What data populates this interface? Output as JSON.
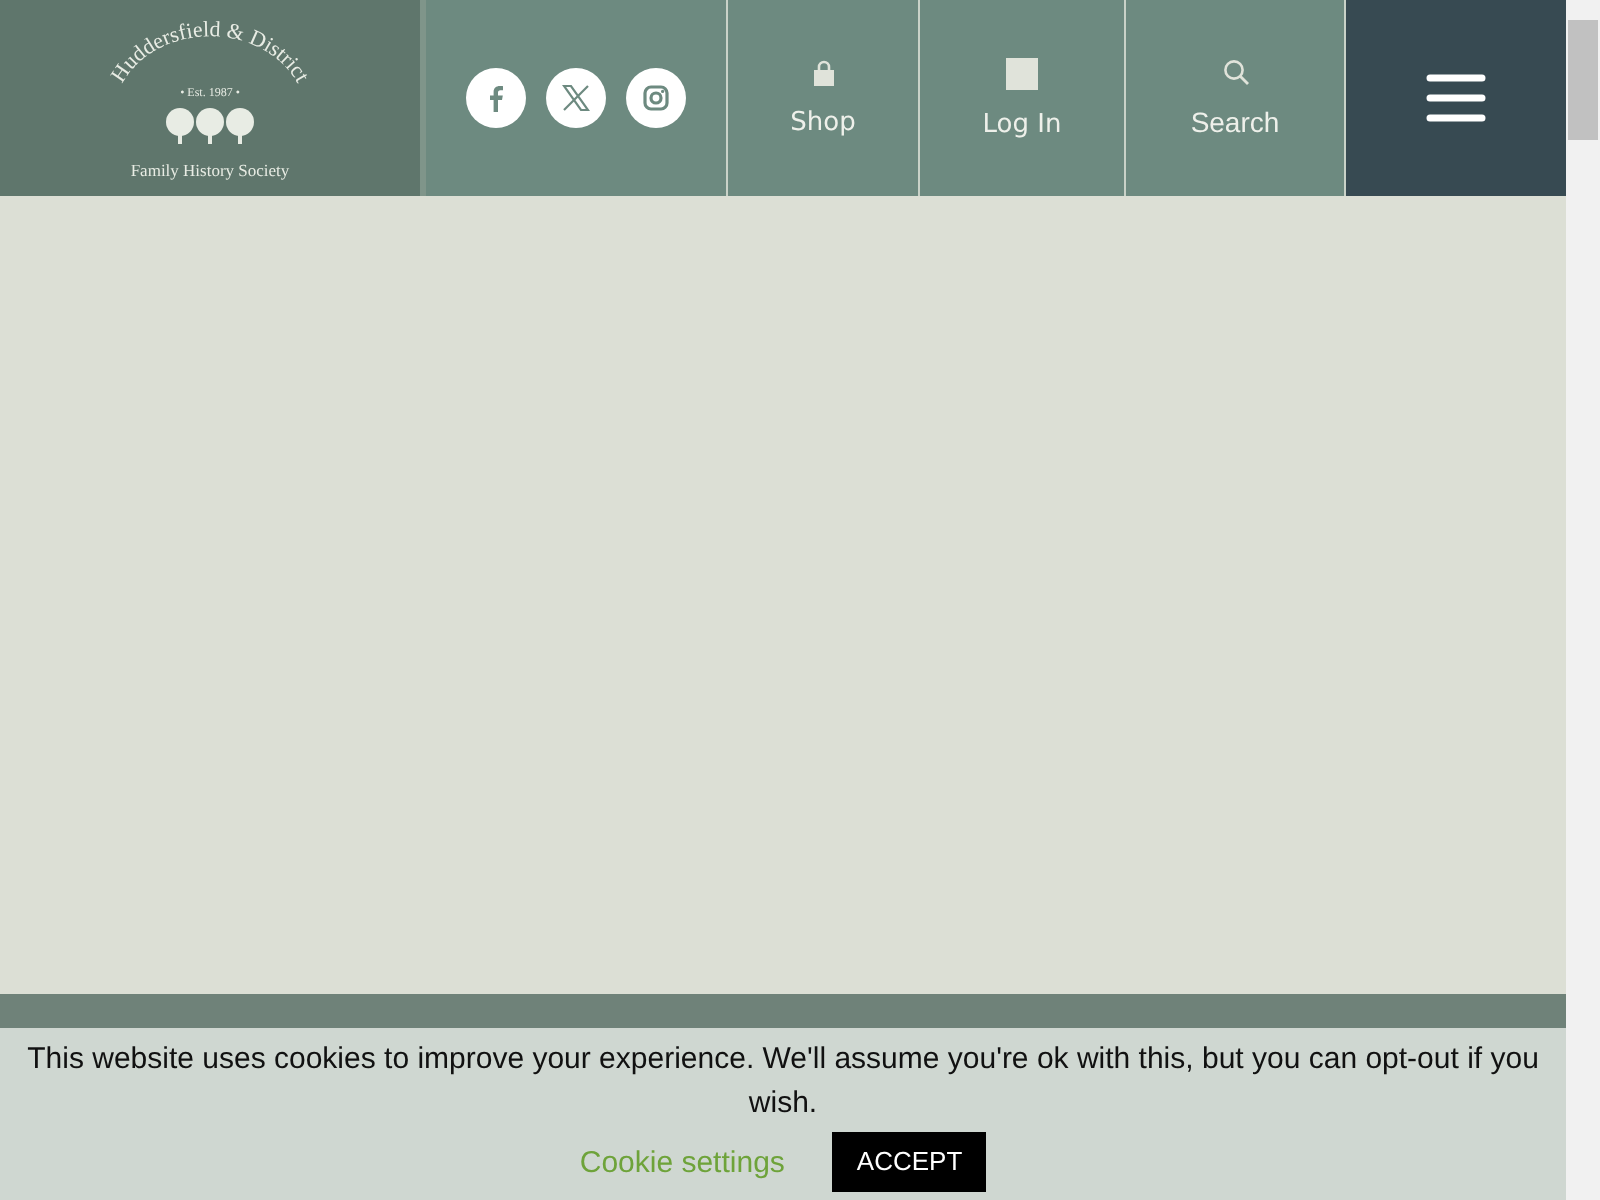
{
  "header": {
    "logo": {
      "arc_text": "Huddersfield & District",
      "established": "• Est. 1987 •",
      "subtitle": "Family History Society"
    },
    "social": [
      {
        "kind": "facebook"
      },
      {
        "kind": "x"
      },
      {
        "kind": "instagram"
      }
    ],
    "nav": [
      {
        "kind": "shop",
        "label": "Shop"
      },
      {
        "kind": "login",
        "label": "Log In"
      },
      {
        "kind": "search",
        "label": "Search"
      }
    ]
  },
  "cookie_banner": {
    "message": "This website uses cookies to improve your experience. We'll assume you're ok with this, but you can opt-out if you wish.",
    "settings_link": "Cookie settings",
    "accept_button": "ACCEPT"
  }
}
